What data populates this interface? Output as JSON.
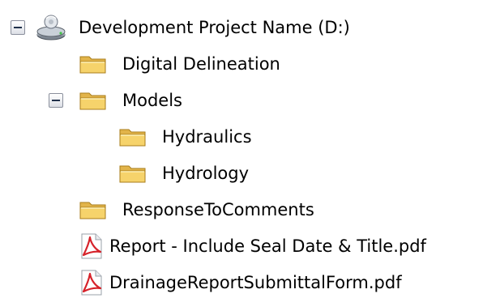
{
  "tree": {
    "drive": {
      "label": "Development Project Name (D:)",
      "icon": "drive-icon",
      "expanded": true
    },
    "items": [
      {
        "label": "Digital Delineation",
        "icon": "folder-icon"
      },
      {
        "label": "Models",
        "icon": "folder-icon",
        "expanded": true
      },
      {
        "label": "Hydraulics",
        "icon": "folder-icon"
      },
      {
        "label": "Hydrology",
        "icon": "folder-icon"
      },
      {
        "label": "ResponseToComments",
        "icon": "folder-icon"
      },
      {
        "label": "Report - Include Seal Date & Title.pdf",
        "icon": "pdf-icon"
      },
      {
        "label": "DrainageReportSubmittalForm.pdf",
        "icon": "pdf-icon"
      }
    ]
  },
  "colors": {
    "folder_body": "#f2cc5c",
    "folder_edge": "#b88a1e",
    "pdf_red": "#d6222a",
    "expander_border": "#8a8f9c"
  }
}
